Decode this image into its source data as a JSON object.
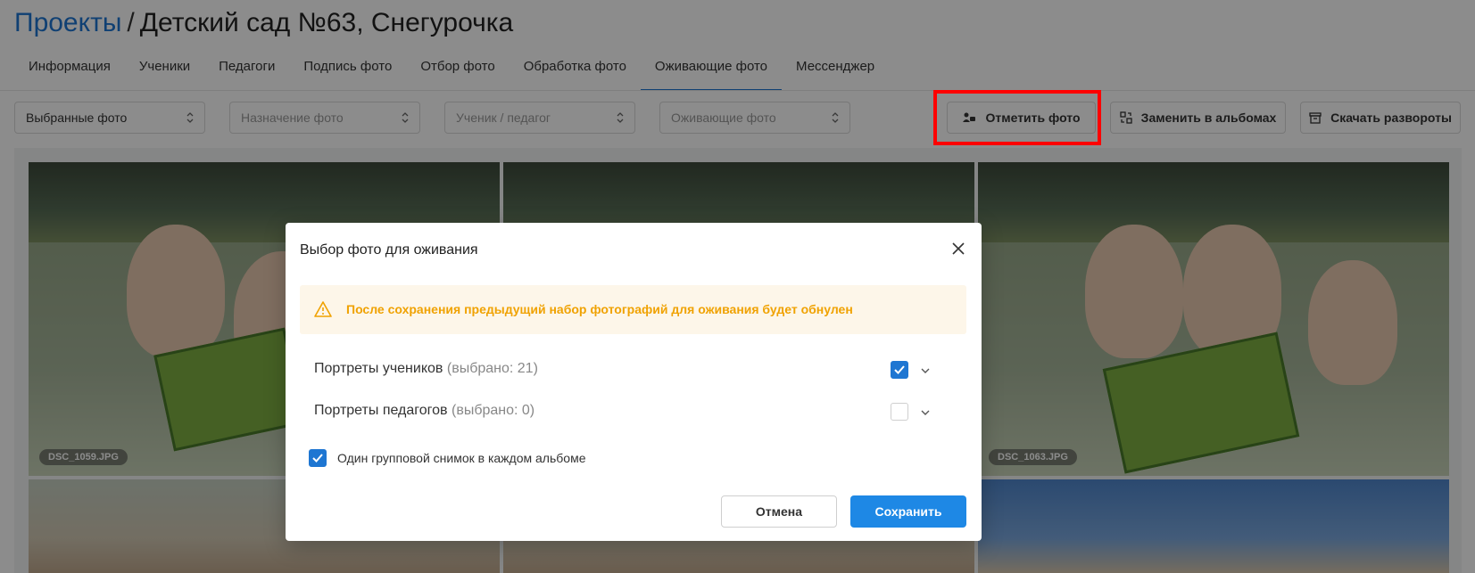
{
  "header": {
    "breadcrumb_link": "Проекты",
    "separator": "/",
    "title": "Детский сад №63, Снегурочка"
  },
  "tabs": [
    {
      "label": "Информация",
      "active": false
    },
    {
      "label": "Ученики",
      "active": false
    },
    {
      "label": "Педагоги",
      "active": false
    },
    {
      "label": "Подпись фото",
      "active": false
    },
    {
      "label": "Отбор фото",
      "active": false
    },
    {
      "label": "Обработка фото",
      "active": false
    },
    {
      "label": "Оживающие фото",
      "active": true
    },
    {
      "label": "Мессенджер",
      "active": false
    }
  ],
  "filters": {
    "photos_select": "Выбранные фото",
    "purpose_placeholder": "Назначение фото",
    "person_placeholder": "Ученик / педагог",
    "animated_placeholder": "Оживающие фото"
  },
  "actions": {
    "mark_photo": "Отметить фото",
    "replace_in_albums": "Заменить в альбомах",
    "download_spreads": "Скачать развороты"
  },
  "photos": [
    {
      "filename": "DSC_1059.JPG"
    },
    {
      "filename": ""
    },
    {
      "filename": "DSC_1063.JPG"
    }
  ],
  "modal": {
    "title": "Выбор фото для оживания",
    "alert": "После сохранения предыдущий набор фотографий для оживания будет обнулен",
    "student_portraits_label": "Портреты учеников",
    "student_portraits_count": "(выбрано: 21)",
    "student_portraits_checked": true,
    "teacher_portraits_label": "Портреты педагогов",
    "teacher_portraits_count": "(выбрано: 0)",
    "teacher_portraits_checked": false,
    "single_group_label": "Один групповой снимок в каждом альбоме",
    "single_group_checked": true,
    "cancel_label": "Отмена",
    "save_label": "Сохранить"
  },
  "colors": {
    "accent": "#1e76d2",
    "save_button": "#1e88e5",
    "warning_text": "#f0a202",
    "warning_bg": "#fdf6e9",
    "highlight": "#ff0000"
  }
}
